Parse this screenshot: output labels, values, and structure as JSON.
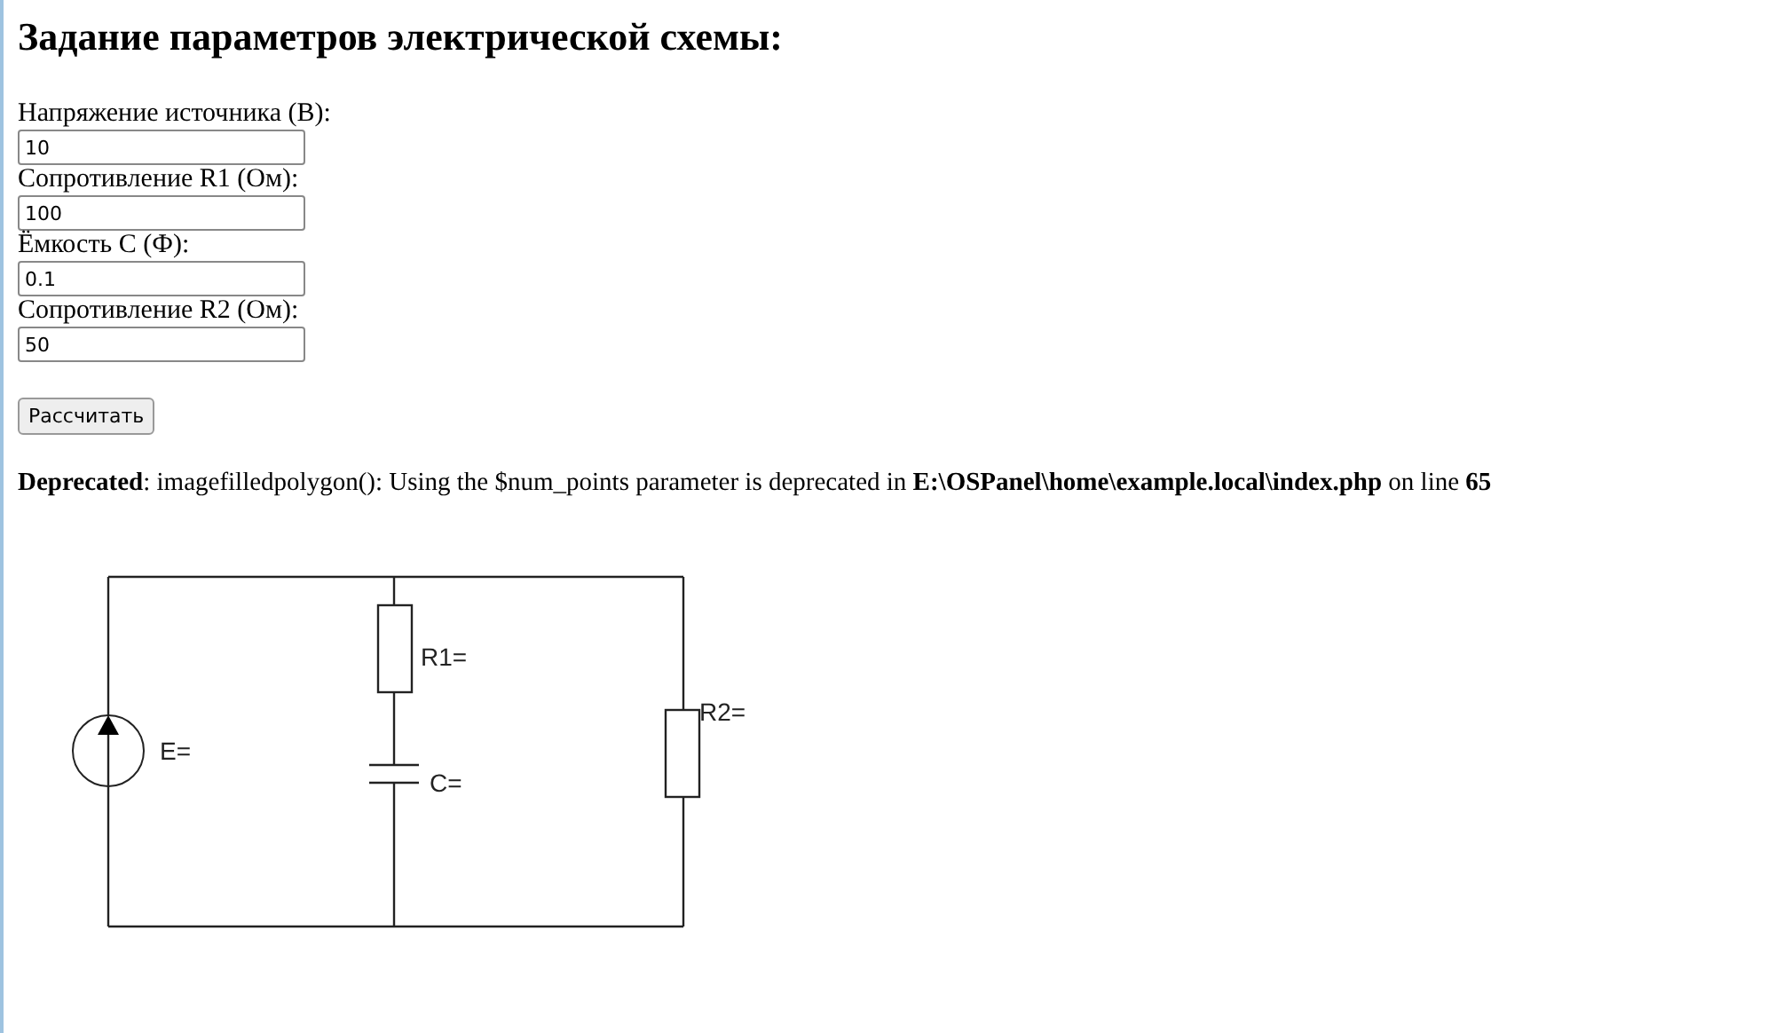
{
  "title": "Задание параметров электрической схемы:",
  "fields": [
    {
      "label": "Напряжение источника (В):",
      "value": "10"
    },
    {
      "label": "Сопротивление R1 (Ом):",
      "value": "100"
    },
    {
      "label": "Ёмкость C (Ф):",
      "value": "0.1"
    },
    {
      "label": "Сопротивление R2 (Ом):",
      "value": "50"
    }
  ],
  "button": "Рассчитать",
  "warning": "**Deprecated**: imagefilledpolygon(): Using the $num_points parameter is deprecated in **E:\\OSPanel\\home\\example.local\\index.php** on line **65**",
  "circuit": {
    "source_label": "E=",
    "r1_label": "R1=",
    "capacitor_label": "C=",
    "r2_label": "R2="
  }
}
